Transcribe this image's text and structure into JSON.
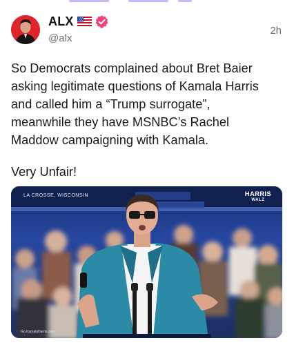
{
  "post": {
    "author_name": "ALX",
    "handle": "@alx",
    "time": "2h",
    "text_lines": [
      "So Democrats complained about Bret Baier",
      "asking legitimate questions of Kamala Harris",
      "and called him a “Trump surrogate”,",
      "meanwhile they have MSNBC’s Rachel",
      "Maddow campaigning with Kamala."
    ],
    "text_tail": "Very Unfair!",
    "media": {
      "location_caption": "LA CROSSE, WISCONSIN",
      "brand_line1": "HARRIS",
      "brand_line2": "WALZ",
      "url_caption": "Go.KamalaHarris.com"
    }
  },
  "icons": {
    "flag": "us-flag-icon",
    "verified": "verified-badge-icon"
  },
  "colors": {
    "verified_badge": "#f0417a",
    "muted_text": "#6b6f76",
    "avatar_bg": "#e0242b",
    "stage_blue": "#1e3a7a"
  }
}
